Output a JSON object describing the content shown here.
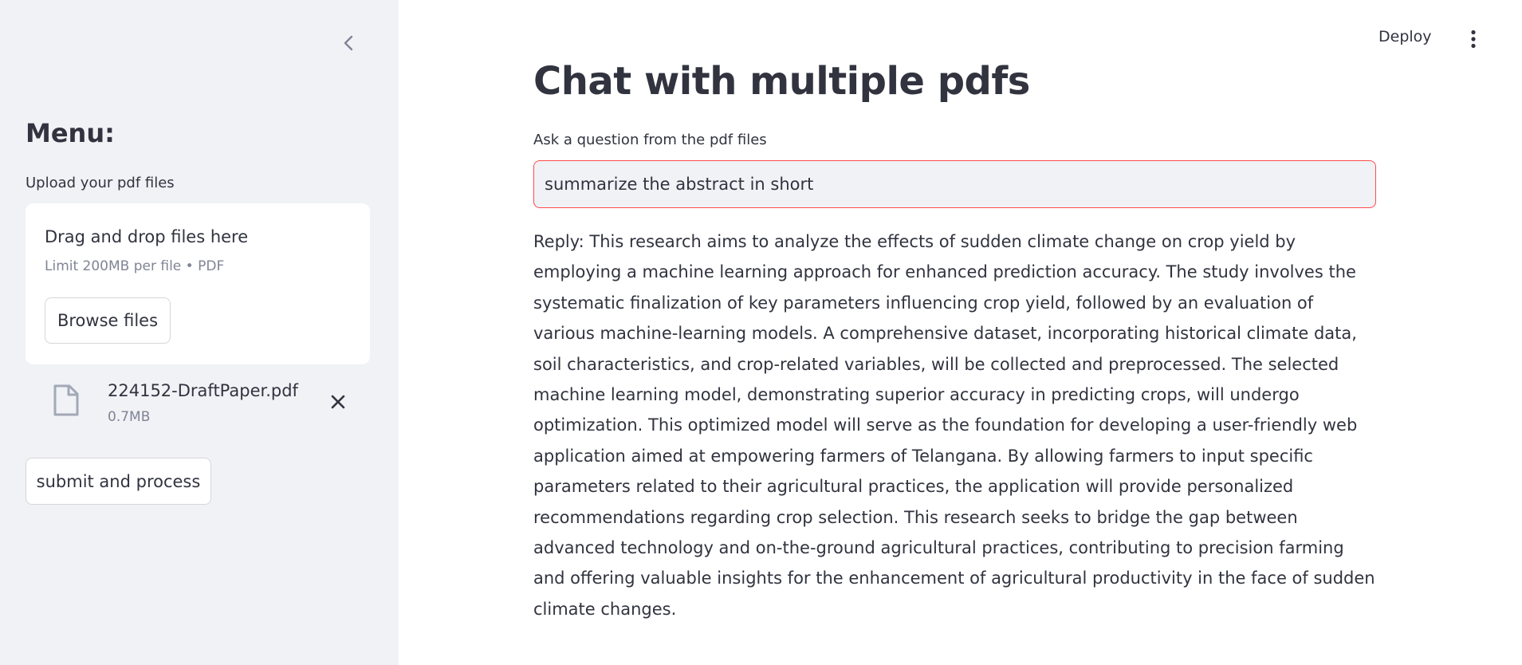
{
  "sidebar": {
    "menu_title": "Menu:",
    "upload_label": "Upload your pdf files",
    "dropzone": {
      "title": "Drag and drop files here",
      "limit": "Limit 200MB per file • PDF",
      "browse_label": "Browse files"
    },
    "files": [
      {
        "name": "224152-DraftPaper.pdf",
        "size": "0.7MB"
      }
    ],
    "submit_label": "submit and process"
  },
  "header": {
    "deploy_label": "Deploy"
  },
  "main": {
    "title": "Chat with multiple pdfs",
    "question_label": "Ask a question from the pdf files",
    "question_value": "summarize the abstract in short",
    "reply": "Reply: This research aims to analyze the effects of sudden climate change on crop yield by employing a machine learning approach for enhanced prediction accuracy. The study involves the systematic finalization of key parameters influencing crop yield, followed by an evaluation of various machine-learning models. A comprehensive dataset, incorporating historical climate data, soil characteristics, and crop-related variables, will be collected and preprocessed. The selected machine learning model, demonstrating superior accuracy in predicting crops, will undergo optimization. This optimized model will serve as the foundation for developing a user-friendly web application aimed at empowering farmers of Telangana. By allowing farmers to input specific parameters related to their agricultural practices, the application will provide personalized recommendations regarding crop selection. This research seeks to bridge the gap between advanced technology and on-the-ground agricultural practices, contributing to precision farming and offering valuable insights for the enhancement of agricultural productivity in the face of sudden climate changes."
  },
  "icons": {
    "collapse": "chevron-left-icon",
    "file": "file-icon",
    "remove": "close-icon",
    "menu": "kebab-menu-icon"
  },
  "colors": {
    "sidebar_bg": "#f0f2f6",
    "text": "#31333f",
    "muted": "#808495",
    "input_focus_border": "#ff4b4b"
  }
}
